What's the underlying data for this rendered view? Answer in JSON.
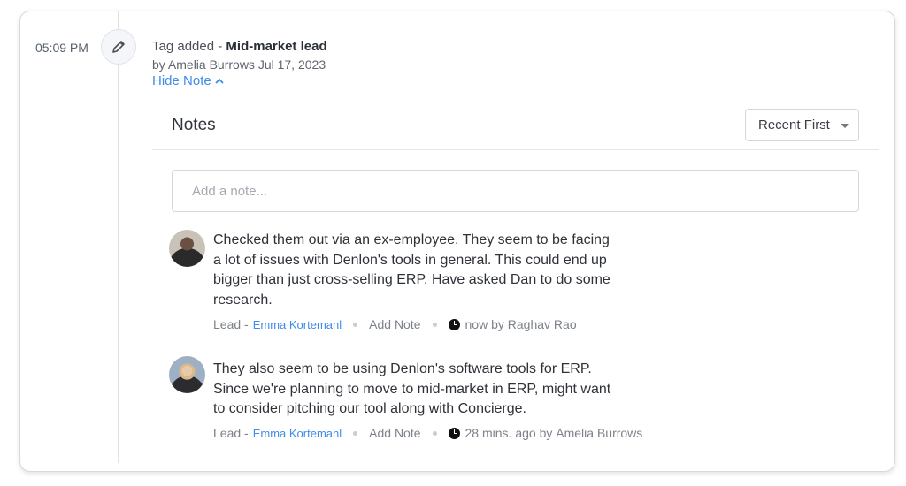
{
  "activity": {
    "time": "05:09 PM",
    "icon": "pencil-icon",
    "title_prefix": "Tag added - ",
    "title_tag": "Mid-market lead",
    "byline": "by Amelia Burrows Jul 17, 2023",
    "toggle_label": "Hide Note"
  },
  "notes": {
    "heading": "Notes",
    "sort_selected": "Recent First",
    "input_placeholder": "Add a note...",
    "items": [
      {
        "text_lines": [
          "Checked them out via an ex-employee. They seem to be facing",
          "a lot of issues with Denlon's tools in general. This could end up",
          "bigger than just cross-selling ERP. Have asked Dan to do some",
          "research."
        ],
        "module": "Lead",
        "separator": "-",
        "record": "Emma Kortemanl",
        "action": "Add Note",
        "time": "now",
        "by": "by",
        "author": "Raghav Rao"
      },
      {
        "text_lines": [
          "They also seem to be using Denlon's software tools for ERP.",
          "Since we're planning to move to mid-market in ERP, might want",
          "to consider pitching our tool along with Concierge."
        ],
        "module": "Lead",
        "separator": "-",
        "record": "Emma Kortemanl",
        "action": "Add Note",
        "time": "28 mins. ago",
        "by": "by",
        "author": "Amelia Burrows"
      }
    ]
  },
  "colors": {
    "link": "#3f8ce8",
    "text": "#2e3238"
  }
}
